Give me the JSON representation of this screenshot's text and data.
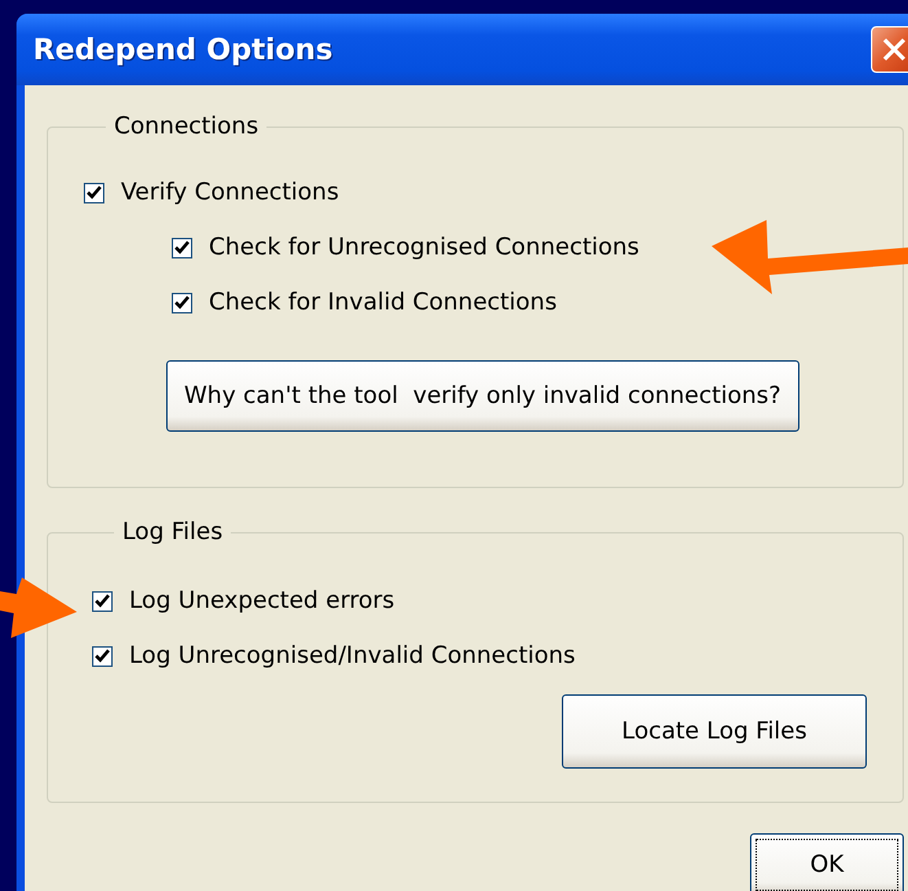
{
  "window": {
    "title": "Redepend Options"
  },
  "connections": {
    "label": "Connections",
    "verify": {
      "label": "Verify Connections",
      "checked": true
    },
    "sub_options": [
      {
        "label": "Check for Unrecognised Connections",
        "checked": true
      },
      {
        "label": "Check for Invalid Connections",
        "checked": true
      }
    ],
    "button": "Why can't the tool  verify only invalid connections?"
  },
  "log_files": {
    "label": "Log Files",
    "options": [
      {
        "label": "Log Unexpected errors",
        "checked": true
      },
      {
        "label": "Log Unrecognised/Invalid Connections",
        "checked": true
      }
    ],
    "button": "Locate Log Files"
  },
  "buttons": [
    {
      "label": "OK",
      "focused": true
    }
  ]
}
